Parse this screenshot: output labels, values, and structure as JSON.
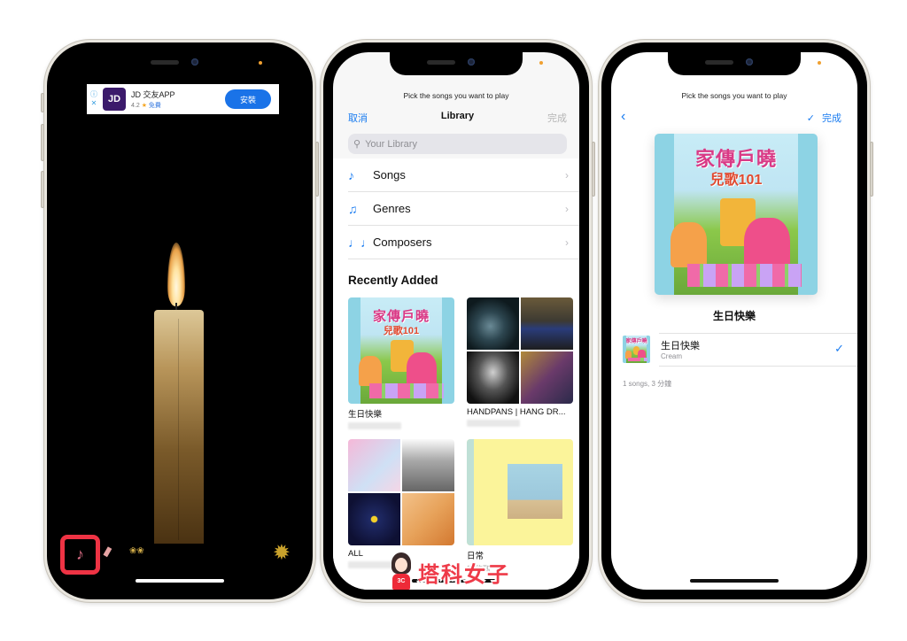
{
  "phone1": {
    "ad": {
      "info_icon": "info-icon",
      "close_icon": "close-icon",
      "logo_text": "JD",
      "title": "JD 交友APP",
      "rating": "4.2",
      "star": "★",
      "price": "免費",
      "install_label": "安裝"
    },
    "toolbar": {
      "music_icon": "♪",
      "flashlight_icon": "🔦",
      "bells_icon": "❀❀",
      "settings_icon": "✹"
    }
  },
  "phone2": {
    "hint": "Pick the songs you want to play",
    "nav": {
      "cancel_label": "取消",
      "title": "Library",
      "done_label": "完成"
    },
    "search": {
      "placeholder": "Your Library",
      "icon": "⚲"
    },
    "library_items": [
      {
        "label": "Songs",
        "icon": "♪"
      },
      {
        "label": "Genres",
        "icon": "♫"
      },
      {
        "label": "Composers",
        "icon": "♩♩"
      }
    ],
    "chevron": "›",
    "recently_added_title": "Recently Added",
    "albums": [
      {
        "title": "生日快樂",
        "subtitle": ""
      },
      {
        "title": "HANDPANS | HANG DR...",
        "subtitle": ""
      },
      {
        "title": "ALL",
        "subtitle": ""
      },
      {
        "title": "日常",
        "subtitle": "田馥甄"
      }
    ],
    "album_art": {
      "kids_title": "家傳戶曉",
      "kids_subtitle": "兒歌101"
    }
  },
  "phone3": {
    "hint": "Pick the songs you want to play",
    "nav": {
      "back_icon": "‹",
      "check_icon": "✓",
      "done_label": "完成"
    },
    "album_art": {
      "kids_title": "家傳戶曉",
      "kids_subtitle": "兒歌101"
    },
    "album_title": "生日快樂",
    "song": {
      "title": "生日快樂",
      "artist": "Cream",
      "selected_icon": "✓"
    },
    "summary": "1 songs, 3 分鐘"
  },
  "watermark": {
    "text": "塔科女子",
    "badge": "3C"
  },
  "colors": {
    "ios_blue": "#1a7cf0",
    "highlight_red": "#ee3344",
    "install_blue": "#1a73e8"
  }
}
